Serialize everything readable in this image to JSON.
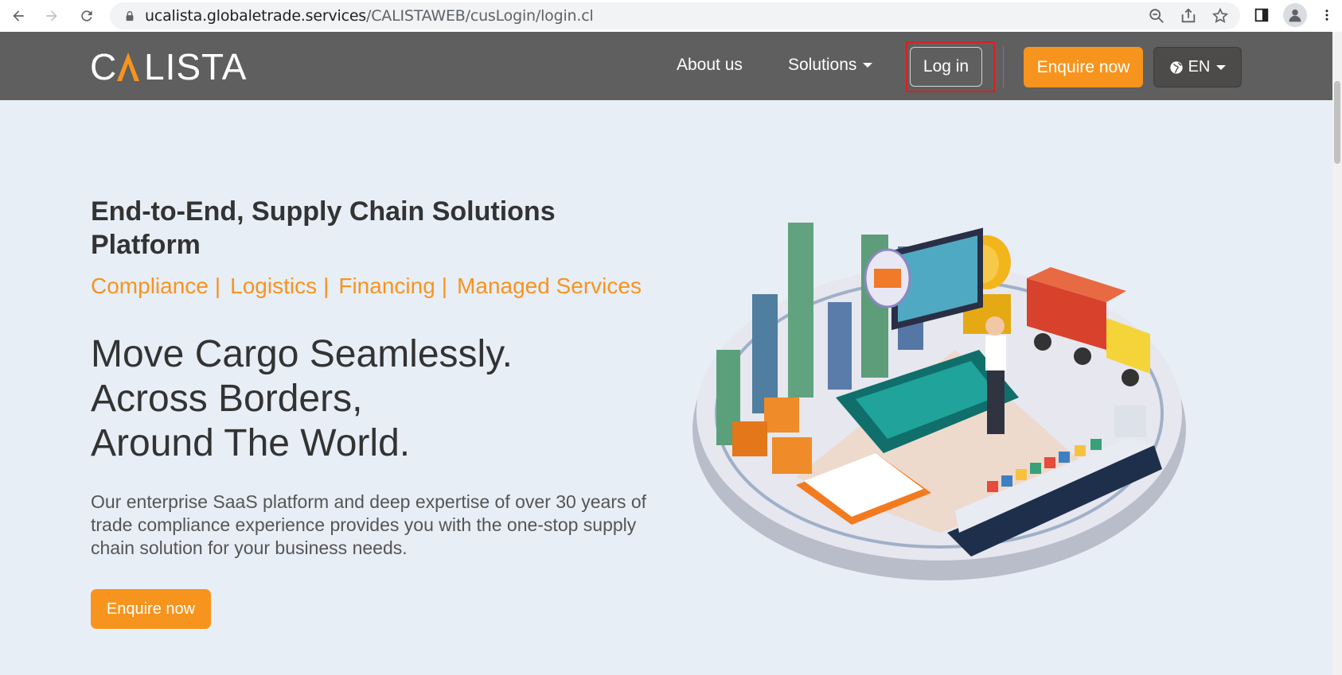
{
  "browser": {
    "url_host": "ucalista.globaletrade.services",
    "url_path": "/CALISTAWEB/cusLogin/login.cl"
  },
  "header": {
    "logo_text": "CALISTA",
    "nav": {
      "about": "About us",
      "solutions": "Solutions",
      "login": "Log in",
      "enquire": "Enquire now",
      "language": "EN"
    }
  },
  "hero": {
    "kicker": "End-to-End, Supply Chain Solutions Platform",
    "tags": [
      "Compliance",
      "Logistics",
      "Financing",
      "Managed Services"
    ],
    "separator": "|",
    "title_lines": [
      "Move Cargo Seamlessly.",
      "Across Borders,",
      "Around The World."
    ],
    "description": "Our enterprise SaaS platform and deep expertise of over 30 years of trade compliance experience provides you with the one-stop supply chain solution for your business needs.",
    "cta": "Enquire now"
  },
  "colors": {
    "accent": "#f7941d",
    "header_bg": "#5f5f5f",
    "page_bg": "#e8eef6",
    "highlight": "#e11d1d"
  }
}
